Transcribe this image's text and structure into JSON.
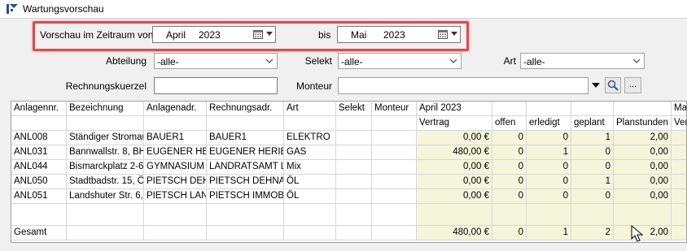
{
  "window": {
    "title": "Wartungsvorschau"
  },
  "filters": {
    "zeitraum_label": "Vorschau im Zeitraum von",
    "from_month": "April",
    "from_year": "2023",
    "bis_label": "bis",
    "to_month": "Mai",
    "to_year": "2023",
    "abteilung_label": "Abteilung",
    "abteilung_value": "-alle-",
    "selekt_label": "Selekt",
    "selekt_value": "-alle-",
    "art_label": "Art",
    "art_value": "-alle-",
    "rechnungskuerzel_label": "Rechnungskuerzel",
    "rechnungskuerzel_value": "",
    "monteur_label": "Monteur",
    "monteur_value": "",
    "more_label": "..."
  },
  "grid": {
    "headers": [
      "Anlagennr.",
      "Bezeichnung",
      "Anlagenadr.",
      "Rechnungsadr.",
      "Art",
      "Selekt",
      "Monteur",
      "April 2023",
      "Ma"
    ],
    "subheaders": [
      "Vertrag",
      "offen",
      "erledigt",
      "geplant",
      "Planstunden",
      "Ver"
    ],
    "rows": [
      [
        "ANL008",
        "Ständiger Stromau",
        "BAUER1",
        "BAUER1",
        "ELEKTRO",
        "",
        "",
        "0,00 €",
        "0",
        "0",
        "1",
        "2,00"
      ],
      [
        "ANL031",
        "Bannwallstr. 8, BH",
        "EUGENER HE",
        "EUGENER HERIB",
        "GAS",
        "",
        "",
        "480,00 €",
        "0",
        "1",
        "0",
        "0,00"
      ],
      [
        "ANL044",
        "Bismarckplatz 2-6",
        "GYMNASIUM :",
        "LANDRATSAMT L",
        "Mix",
        "",
        "",
        "0,00 €",
        "0",
        "0",
        "0",
        "0,00"
      ],
      [
        "ANL050",
        "Stadtbadstr. 15, Ö",
        "PIETSCH DEH",
        "PIETSCH DEHNAI",
        "ÖL",
        "",
        "",
        "0,00 €",
        "0",
        "0",
        "1",
        "0,00"
      ],
      [
        "ANL051",
        "Landshuter Str. 6,",
        "PIETSCH LAN",
        "PIETSCH IMMOBI",
        "ÖL",
        "",
        "",
        "0,00 €",
        "0",
        "0",
        "0",
        "0,00"
      ]
    ],
    "total": [
      "Gesamt",
      "480,00 €",
      "0",
      "1",
      "2",
      "2,00"
    ]
  }
}
